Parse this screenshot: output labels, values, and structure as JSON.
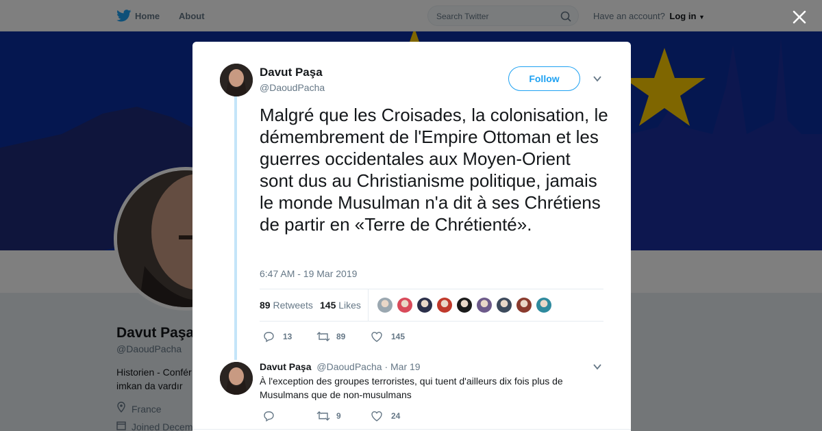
{
  "topbar": {
    "home_label": "Home",
    "about_label": "About",
    "search_placeholder": "Search Twitter",
    "account_prompt": "Have an account?",
    "login_label": "Log in"
  },
  "profile": {
    "name": "Davut Paşa",
    "handle": "@DaoudPacha",
    "bio": "Historien - Conférencier ... imkan da vardır",
    "bio_line1": "Historien - Confér",
    "bio_line2": "imkan da vardır",
    "location": "France",
    "joined": "Joined Decem"
  },
  "tweet": {
    "author_name": "Davut Paşa",
    "author_handle": "@DaoudPacha",
    "follow_label": "Follow",
    "text": "Malgré que les Croisades, la colonisation, le démembrement de l'Empire Ottoman et les guerres occidentales aux Moyen-Orient sont dus au Christianisme politique, jamais le monde Musulman n'a dit à ses Chrétiens de partir en «Terre de Chrétienté».",
    "timestamp": "6:47 AM - 19 Mar 2019",
    "retweets_count": "89",
    "retweets_label": "Retweets",
    "likes_count": "145",
    "likes_label": "Likes",
    "likers_count": 9,
    "actions": {
      "replies": "13",
      "retweets": "89",
      "likes": "145"
    }
  },
  "reply": {
    "author_name": "Davut Paşa",
    "author_handle": "@DaoudPacha",
    "date": "· Mar 19",
    "text": "À l'exception des groupes terroristes, qui tuent d'ailleurs dix fois plus de Musulmans que de non-musulmans",
    "actions": {
      "replies": "",
      "retweets": "9",
      "likes": "24"
    }
  },
  "colors": {
    "brand_blue": "#1da1f2",
    "thread_line": "#c4e5f9",
    "text_secondary": "#657786",
    "banner_blue": "#0a2fa0",
    "star_yellow": "#ffcc00"
  },
  "icons": [
    "twitter-bird-icon",
    "search-icon",
    "close-icon",
    "chevron-down-icon",
    "reply-icon",
    "retweet-icon",
    "heart-icon",
    "location-icon",
    "calendar-icon"
  ]
}
